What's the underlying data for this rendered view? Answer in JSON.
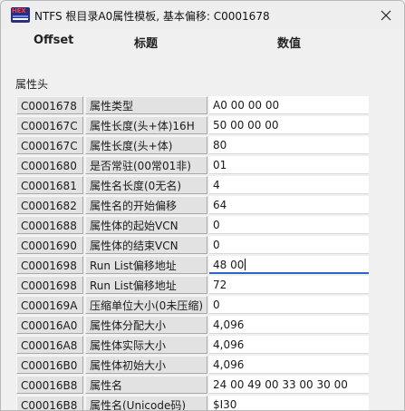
{
  "window": {
    "title": "NTFS 根目录A0属性模板, 基本偏移: C0001678",
    "app_icon_text": "HEX"
  },
  "headers": {
    "offset": "Offset",
    "title": "标题",
    "value": "数值"
  },
  "section_label": "属性头",
  "rows": [
    {
      "offset": "C0001678",
      "title": "属性类型",
      "value": "A0 00 00 00"
    },
    {
      "offset": "C000167C",
      "title": "属性长度(头+体)16H",
      "value": "50 00 00 00"
    },
    {
      "offset": "C000167C",
      "title": "属性长度(头+体)",
      "value": "80"
    },
    {
      "offset": "C0001680",
      "title": "是否常驻(00常01非)",
      "value": "01"
    },
    {
      "offset": "C0001681",
      "title": "属性名长度(0无名)",
      "value": "4"
    },
    {
      "offset": "C0001682",
      "title": "属性名的开始偏移",
      "value": "64"
    },
    {
      "offset": "C0001688",
      "title": "属性体的起始VCN",
      "value": "0"
    },
    {
      "offset": "C0001690",
      "title": "属性体的结束VCN",
      "value": "0"
    },
    {
      "offset": "C0001698",
      "title": "Run List偏移地址",
      "value": "48 00"
    },
    {
      "offset": "C0001698",
      "title": "Run List偏移地址",
      "value": "72"
    },
    {
      "offset": "C000169A",
      "title": "压缩单位大小(0未压缩)",
      "value": "0"
    },
    {
      "offset": "C00016A0",
      "title": "属性体分配大小",
      "value": "4,096"
    },
    {
      "offset": "C00016A8",
      "title": "属性体实际大小",
      "value": "4,096"
    },
    {
      "offset": "C00016B0",
      "title": "属性体初始大小",
      "value": "4,096"
    },
    {
      "offset": "C00016B8",
      "title": "属性名",
      "value": "24 00 49 00 33 00 30 00"
    },
    {
      "offset": "C00016B8",
      "title": "属性名(Unicode码)",
      "value": "$I30"
    }
  ],
  "active_row_index": 8,
  "colors": {
    "accent": "#2a66c4",
    "label_bg": "#e2e2e2",
    "window_bg": "#f0f0f0"
  }
}
